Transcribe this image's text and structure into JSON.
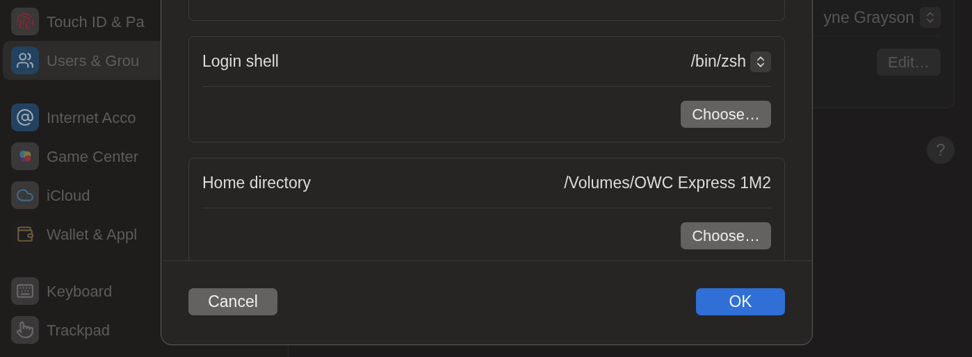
{
  "sidebar": {
    "items": [
      {
        "label": "Touch ID & Pa",
        "selected": false
      },
      {
        "label": "Users & Grou",
        "selected": true
      },
      {
        "label": "Internet Acco",
        "selected": false
      },
      {
        "label": "Game Center",
        "selected": false
      },
      {
        "label": "iCloud",
        "selected": false
      },
      {
        "label": "Wallet & Appl",
        "selected": false
      },
      {
        "label": "Keyboard",
        "selected": false
      },
      {
        "label": "Trackpad",
        "selected": false
      }
    ]
  },
  "background_panel": {
    "user_name": "yne Grayson",
    "edit_button": "Edit…",
    "help_button": "?"
  },
  "dialog": {
    "rows": [
      {
        "kind": "popup",
        "label": "Login shell",
        "value": "/bin/zsh",
        "button": "Choose…"
      },
      {
        "kind": "text",
        "label": "Home directory",
        "value": "/Volumes/OWC Express 1M2",
        "button": "Choose…"
      }
    ],
    "buttons": [
      {
        "label": "Cancel",
        "default": false
      },
      {
        "label": "OK",
        "default": true
      }
    ]
  }
}
